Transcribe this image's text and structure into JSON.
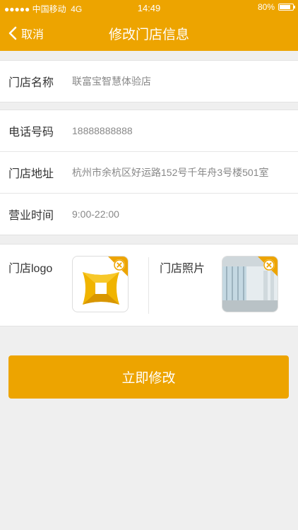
{
  "status_bar": {
    "carrier": "●●●●● 中国移动",
    "network": "4G",
    "time": "14:49",
    "battery": "80%"
  },
  "nav": {
    "back_label": "取消",
    "title": "修改门店信息"
  },
  "store_name": {
    "label": "门店名称",
    "value": "联富宝智慧体验店"
  },
  "contact": [
    {
      "label": "电话号码",
      "value": "18888888888"
    },
    {
      "label": "门店地址",
      "value": "杭州市余杭区好运路152号千年舟3号楼501室"
    },
    {
      "label": "营业时间",
      "value": "9:00-22:00"
    }
  ],
  "media": {
    "logo_label": "门店logo",
    "photo_label": "门店照片"
  },
  "submit_label": "立即修改",
  "colors": {
    "accent": "#eda400",
    "background": "#efefef"
  },
  "icons": {
    "back": "chevron-left-icon",
    "remove": "close-circle-icon"
  }
}
